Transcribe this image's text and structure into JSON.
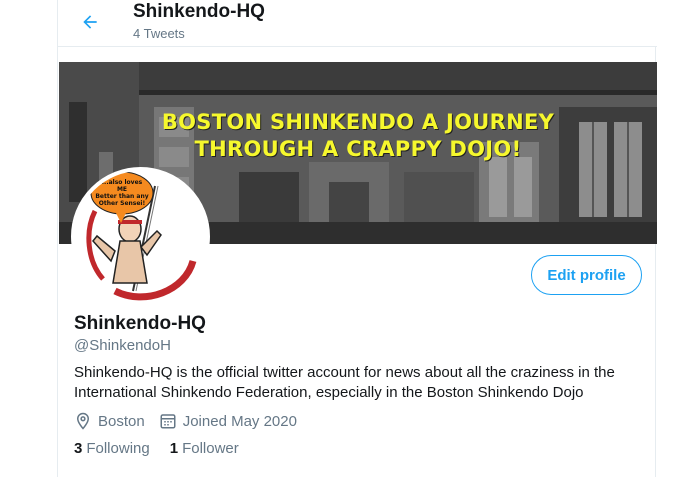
{
  "colors": {
    "accent": "#1da1f2",
    "muted": "#657786",
    "text": "#14171a",
    "banner_text": "#f6f82d"
  },
  "header": {
    "back_icon": "arrow-left-icon",
    "title": "Shinkendo-HQ",
    "tweet_count": "4 Tweets"
  },
  "banner": {
    "line1": "BOSTON SHINKENDO A JOURNEY",
    "line2": "THROUGH A CRAPPY DOJO!"
  },
  "avatar": {
    "speech_bubble": [
      "...also loves",
      "ME",
      "Better than any",
      "Other Sensei!"
    ]
  },
  "profile": {
    "edit_label": "Edit profile",
    "name": "Shinkendo-HQ",
    "handle": "@ShinkendoH",
    "bio_line1": "Shinkendo-HQ is the official twitter account for news about all the craziness in the",
    "bio_line2": "International Shinkendo Federation, especially in the Boston Shinkendo Dojo",
    "location_icon": "location-pin-icon",
    "location": "Boston",
    "joined_icon": "calendar-icon",
    "joined": "Joined May 2020",
    "following_count": "3",
    "following_label": "Following",
    "followers_count": "1",
    "followers_label": "Follower"
  }
}
